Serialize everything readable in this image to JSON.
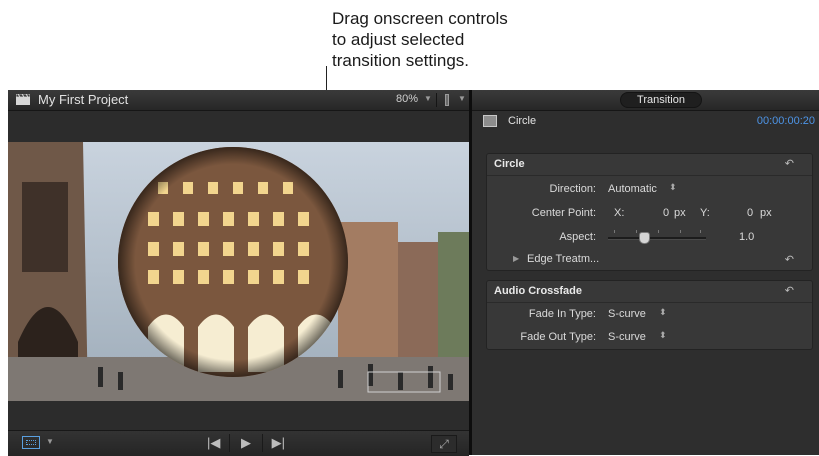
{
  "callout": {
    "lines": [
      "Drag onscreen controls",
      "to adjust selected",
      "transition settings."
    ]
  },
  "viewer": {
    "title": "My First Project",
    "zoom": "80%",
    "icons": [
      "clapper-icon",
      "chevron-down-icon",
      "audio-meter-icon",
      "format-icon",
      "previous-icon",
      "play-icon",
      "next-icon",
      "fullscreen-icon"
    ]
  },
  "inspector": {
    "tab": "Transition",
    "item_name": "Circle",
    "duration": "00:00:00:20",
    "circle": {
      "title": "Circle",
      "direction_label": "Direction:",
      "direction_value": "Automatic",
      "center_label": "Center Point:",
      "x_label": "X:",
      "x_value": "0",
      "y_label": "Y:",
      "y_value": "0",
      "unit": "px",
      "aspect_label": "Aspect:",
      "aspect_value": "1.0",
      "aspect_slider_fraction": 0.37,
      "edge_label": "Edge Treatm..."
    },
    "audio": {
      "title": "Audio Crossfade",
      "fade_in_label": "Fade In Type:",
      "fade_in_value": "S-curve",
      "fade_out_label": "Fade Out Type:",
      "fade_out_value": "S-curve"
    }
  },
  "colors": {
    "accent": "#4d94e6",
    "panel": "#2e2e2e"
  }
}
